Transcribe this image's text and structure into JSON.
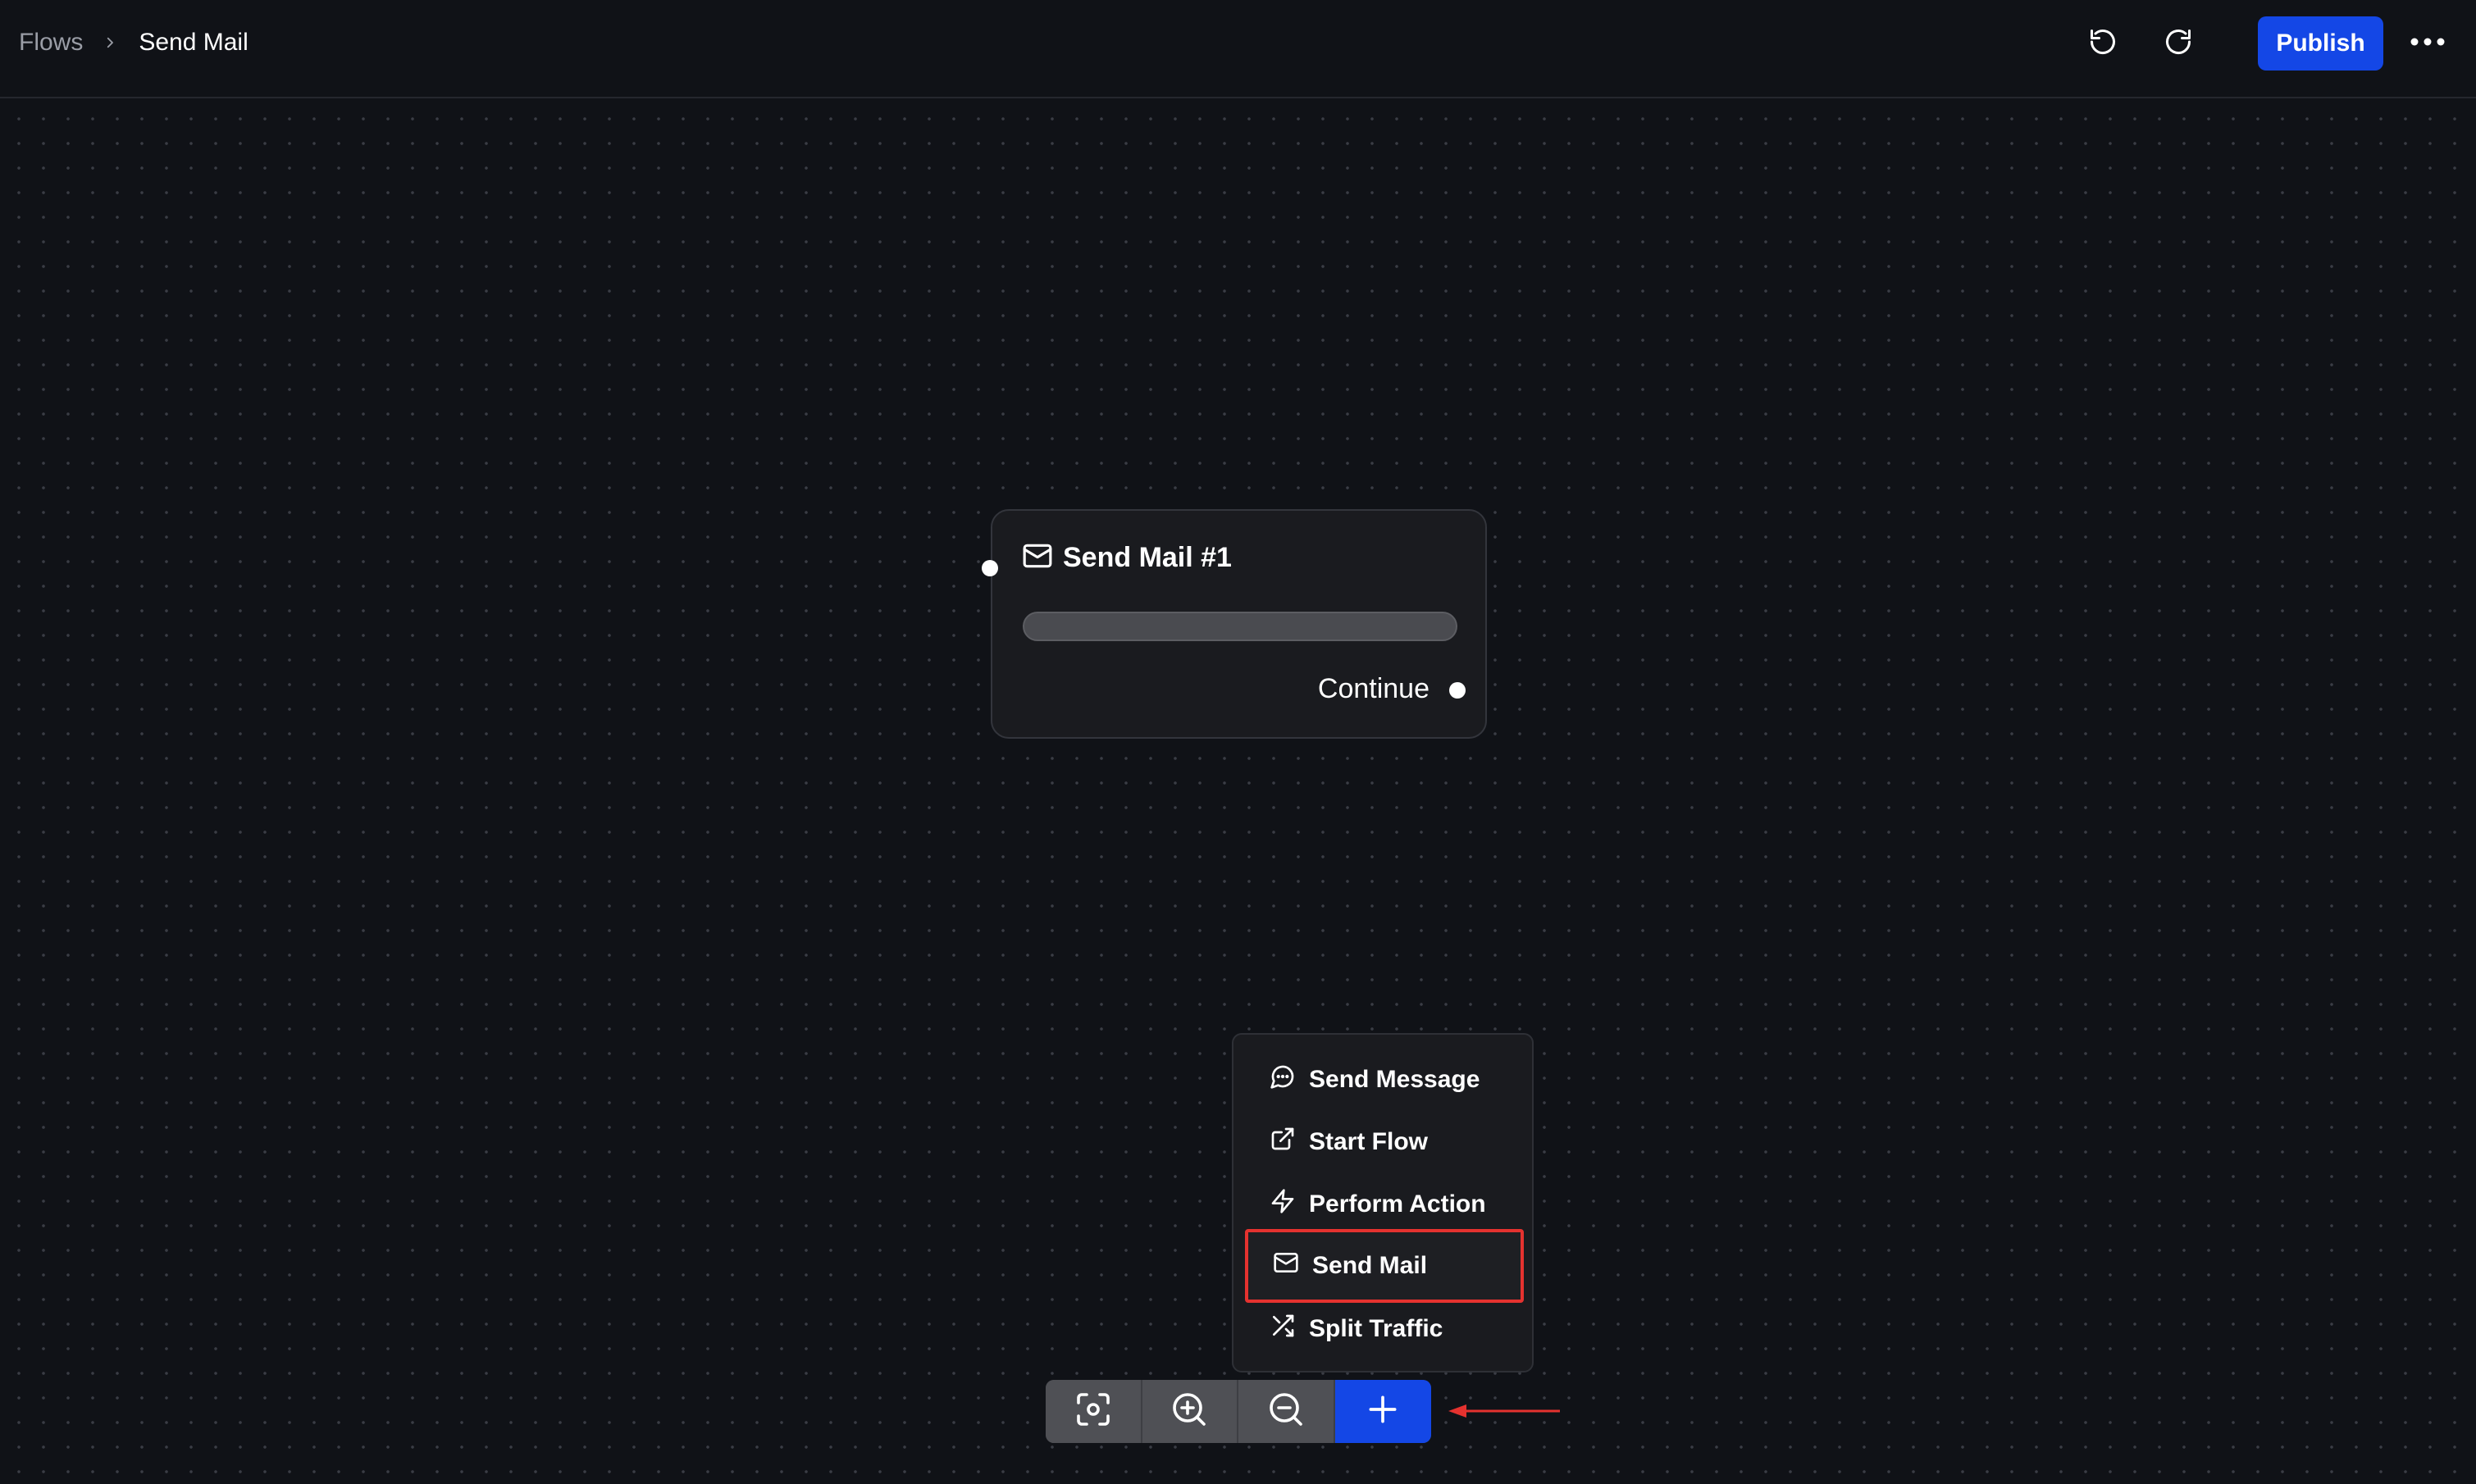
{
  "header": {
    "breadcrumb_root": "Flows",
    "breadcrumb_current": "Send Mail",
    "publish_label": "Publish"
  },
  "node": {
    "title": "Send Mail #1",
    "output_label": "Continue"
  },
  "menu": {
    "items": [
      {
        "label": "Send Message",
        "icon": "message-circle-icon"
      },
      {
        "label": "Start Flow",
        "icon": "external-link-icon"
      },
      {
        "label": "Perform Action",
        "icon": "lightning-bolt-icon"
      },
      {
        "label": "Send Mail",
        "icon": "mail-icon",
        "highlighted": true
      },
      {
        "label": "Split Traffic",
        "icon": "shuffle-icon"
      }
    ]
  },
  "toolbar": {
    "tools": [
      "fit-view-icon",
      "zoom-in-icon",
      "zoom-out-icon",
      "plus-icon"
    ]
  },
  "colors": {
    "background": "#101217",
    "accent": "#1447e6",
    "highlight_border": "#e5322f",
    "annotation_arrow": "#e5322f"
  }
}
